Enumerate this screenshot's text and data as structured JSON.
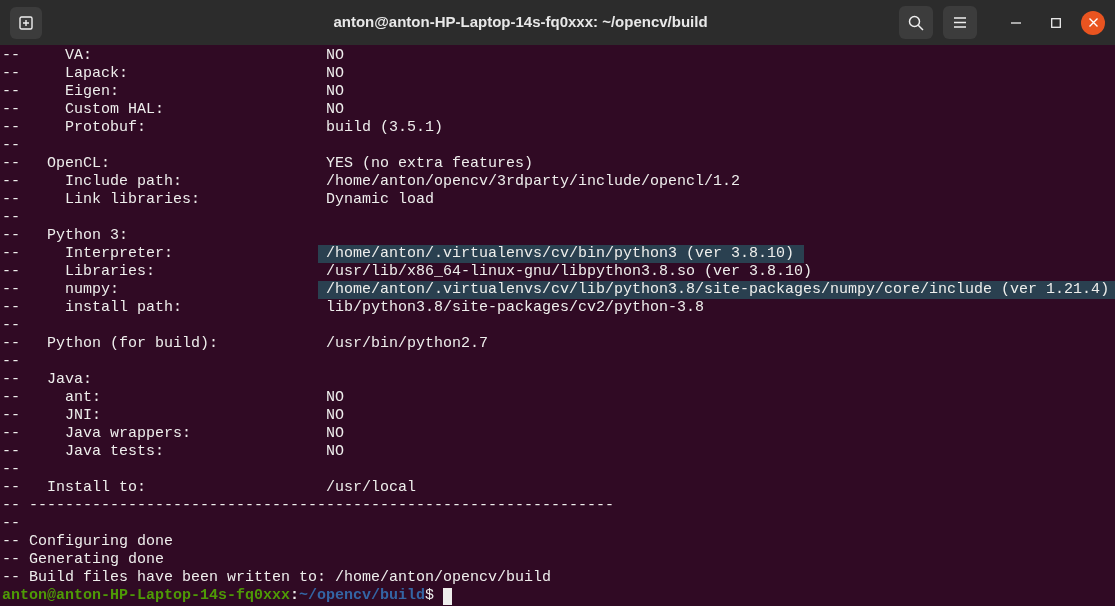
{
  "window": {
    "title": "anton@anton-HP-Laptop-14s-fq0xxx: ~/opencv/build"
  },
  "lines": [
    {
      "label": "--     VA:",
      "value": "NO",
      "selected": false
    },
    {
      "label": "--     Lapack:",
      "value": "NO",
      "selected": false
    },
    {
      "label": "--     Eigen:",
      "value": "NO",
      "selected": false
    },
    {
      "label": "--     Custom HAL:",
      "value": "NO",
      "selected": false
    },
    {
      "label": "--     Protobuf:",
      "value": "build (3.5.1)",
      "selected": false
    },
    {
      "label": "--",
      "selected": false
    },
    {
      "label": "--   OpenCL:",
      "value": "YES (no extra features)",
      "selected": false
    },
    {
      "label": "--     Include path:",
      "value": "/home/anton/opencv/3rdparty/include/opencl/1.2",
      "selected": false
    },
    {
      "label": "--     Link libraries:",
      "value": "Dynamic load",
      "selected": false
    },
    {
      "label": "--",
      "selected": false
    },
    {
      "label": "--   Python 3:",
      "selected": false
    },
    {
      "label": "--     Interpreter:",
      "value": "/home/anton/.virtualenvs/cv/bin/python3 (ver 3.8.10)",
      "selected": true
    },
    {
      "label": "--     Libraries:",
      "value": "/usr/lib/x86_64-linux-gnu/libpython3.8.so (ver 3.8.10)",
      "selected": false
    },
    {
      "label": "--     numpy:",
      "value": "/home/anton/.virtualenvs/cv/lib/python3.8/site-packages/numpy/core/include (ver 1.21.4)",
      "selected": true
    },
    {
      "label": "--     install path:",
      "value": "lib/python3.8/site-packages/cv2/python-3.8",
      "selected": false
    },
    {
      "label": "--",
      "selected": false
    },
    {
      "label": "--   Python (for build):",
      "value": "/usr/bin/python2.7",
      "selected": false
    },
    {
      "label": "--",
      "selected": false
    },
    {
      "label": "--   Java:",
      "selected": false
    },
    {
      "label": "--     ant:",
      "value": "NO",
      "selected": false
    },
    {
      "label": "--     JNI:",
      "value": "NO",
      "selected": false
    },
    {
      "label": "--     Java wrappers:",
      "value": "NO",
      "selected": false
    },
    {
      "label": "--     Java tests:",
      "value": "NO",
      "selected": false
    },
    {
      "label": "--",
      "selected": false
    },
    {
      "label": "--   Install to:",
      "value": "/usr/local",
      "selected": false
    },
    {
      "label": "-- -----------------------------------------------------------------",
      "selected": false
    },
    {
      "label": "--",
      "selected": false
    },
    {
      "label": "-- Configuring done",
      "selected": false
    },
    {
      "label": "-- Generating done",
      "selected": false
    },
    {
      "label": "-- Build files have been written to: /home/anton/opencv/build",
      "selected": false
    }
  ],
  "prompt": {
    "user_host": "anton@anton-HP-Laptop-14s-fq0xxx",
    "separator": ":",
    "path": "~/opencv/build",
    "symbol": "$"
  }
}
